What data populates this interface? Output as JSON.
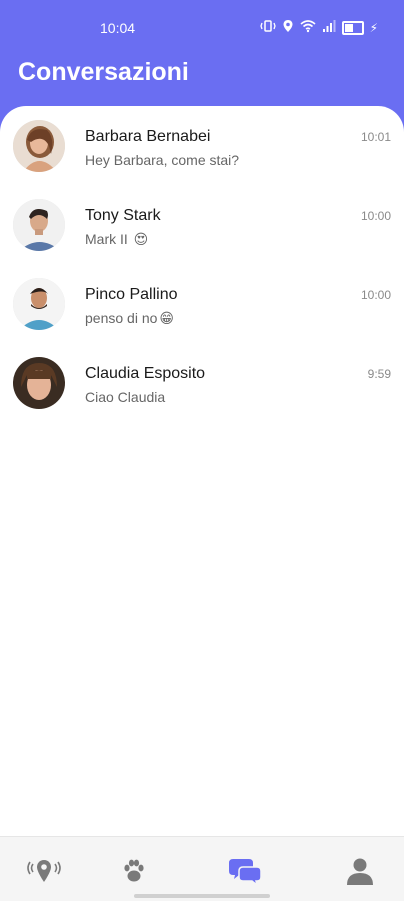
{
  "status": {
    "time": "10:04"
  },
  "page": {
    "title": "Conversazioni"
  },
  "conversations": [
    {
      "name": "Barbara Bernabei",
      "message": "Hey Barbara, come stai?",
      "time": "10:01"
    },
    {
      "name": "Tony Stark",
      "message": "Mark II",
      "emoji": "😍",
      "time": "10:00"
    },
    {
      "name": "Pinco Pallino",
      "message": "penso di no",
      "emoji": "😁",
      "time": "10:00"
    },
    {
      "name": "Claudia Esposito",
      "message": "Ciao Claudia",
      "time": "9:59"
    }
  ],
  "nav": {
    "items": [
      {
        "icon": "location-icon",
        "active": false
      },
      {
        "icon": "paw-icon",
        "active": false
      },
      {
        "icon": "chat-bubbles-icon",
        "active": true
      },
      {
        "icon": "profile-icon",
        "active": false
      }
    ],
    "active_color": "#6a6ef2",
    "inactive_color": "#7a7a7a"
  },
  "colors": {
    "header": "#6a6ef2"
  }
}
